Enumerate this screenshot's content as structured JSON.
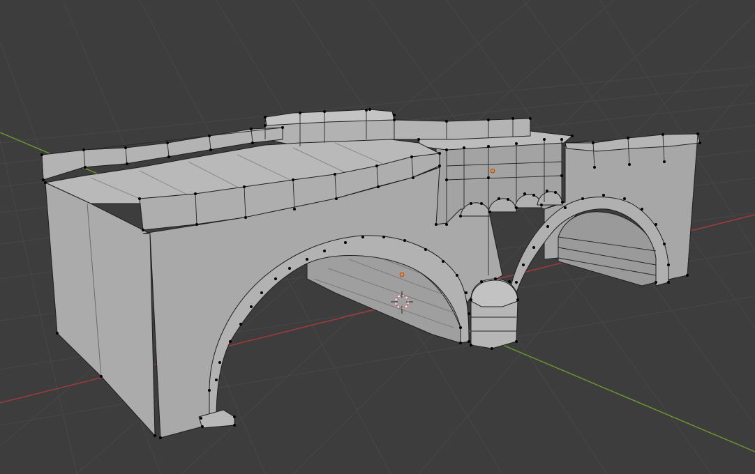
{
  "app": "Blender",
  "viewport": {
    "mode": "edit-mode",
    "shading": "solid",
    "background": "#3d3d3d",
    "grid_color": "#4a4a4a",
    "axis_x_color": "#a83a3a",
    "axis_y_color": "#6b9a2e",
    "mesh_face_color": "#a9a9a9",
    "mesh_edge_color": "#1c1c1c",
    "vertex_color": "#000000",
    "origin_color": "#f0803a",
    "cursor_color": "#e06060"
  },
  "scene": {
    "object": "stone-bridge-wall-with-arches",
    "cursor_icon": "3d-cursor-icon",
    "origin_icon": "object-origin-icon"
  }
}
